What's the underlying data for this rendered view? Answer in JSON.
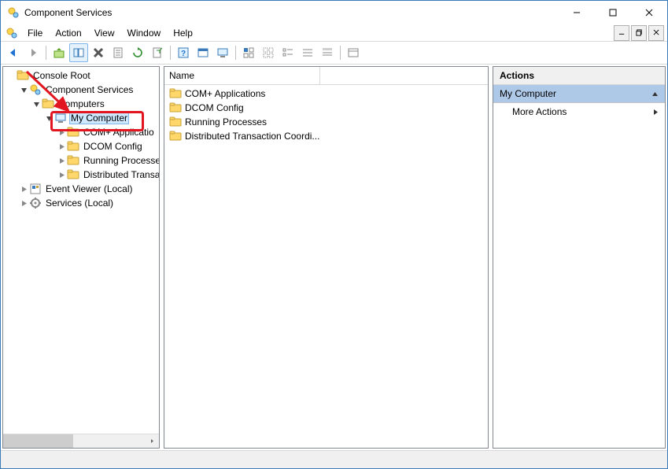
{
  "window": {
    "title": "Component Services"
  },
  "menu": {
    "file": "File",
    "action": "Action",
    "view": "View",
    "window": "Window",
    "help": "Help"
  },
  "tree": {
    "root": "Console Root",
    "cs": "Component Services",
    "computers": "Computers",
    "mycomputer": "My Computer",
    "complus": "COM+ Applications",
    "dcom": "DCOM Config",
    "running": "Running Processes",
    "dtc": "Distributed Transaction Coordinator",
    "complus_trunc": "COM+ Applicatio",
    "running_trunc": "Running Processe",
    "dtc_trunc": "Distributed Transa",
    "event": "Event Viewer (Local)",
    "services": "Services (Local)"
  },
  "list": {
    "col_name": "Name",
    "items": [
      "COM+ Applications",
      "DCOM Config",
      "Running Processes",
      "Distributed Transaction Coordi..."
    ]
  },
  "actions": {
    "title": "Actions",
    "subtitle": "My Computer",
    "more": "More Actions"
  },
  "colors": {
    "accent": "#3a7ab8",
    "selection": "#cde8ff",
    "annotation": "#e11620"
  }
}
